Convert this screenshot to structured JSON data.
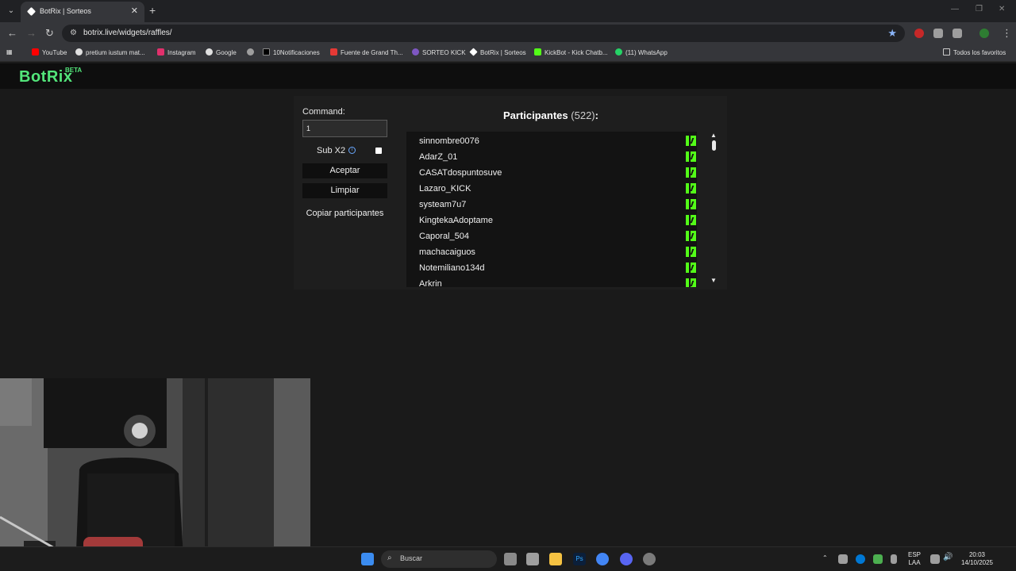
{
  "browser": {
    "tab_title": "BotRix | Sorteos",
    "url": "botrix.live/widgets/raffles/",
    "bookmarks": [
      {
        "label": "YouTube",
        "color": "#ff0000"
      },
      {
        "label": "pretium iustum mat...",
        "color": "#e0e0e0"
      },
      {
        "label": "Instagram",
        "color": "#e1306c"
      },
      {
        "label": "Google",
        "color": "#e0e0e0"
      },
      {
        "label": "",
        "color": "#9e9e9e"
      },
      {
        "label": "10Notificaciones",
        "color": "#000000"
      },
      {
        "label": "Fuente de Grand Th...",
        "color": "#e53935"
      },
      {
        "label": "SORTEO KICK",
        "color": "#7e57c2"
      },
      {
        "label": "BotRix | Sorteos",
        "color": "#ffffff"
      },
      {
        "label": "KickBot - Kick Chatb...",
        "color": "#53fc18"
      },
      {
        "label": "(11) WhatsApp",
        "color": "#25d366"
      }
    ],
    "all_bookmarks": "Todos los favoritos"
  },
  "app": {
    "logo": "BotRix",
    "beta": "BETA"
  },
  "raffle": {
    "command_label": "Command:",
    "command_value": "1",
    "sub_label": "Sub X2",
    "sub_checked": false,
    "accept": "Aceptar",
    "clear": "Limpiar",
    "copy": "Copiar participantes",
    "participants_title": "Participantes",
    "participants_count": "(522)",
    "colon": ":",
    "participants": [
      "sinnombre0076",
      "AdarZ_01",
      "CASATdospuntosuve",
      "Lazaro_KICK",
      "systeam7u7",
      "KingtekaAdoptame",
      "Caporal_504",
      "machacaiguos",
      "Notemiliano134d",
      "Arkrin"
    ]
  },
  "taskbar": {
    "search": "Buscar",
    "lang_top": "ESP",
    "lang_bottom": "LAA",
    "time": "20:03",
    "date": "14/10/2025"
  }
}
